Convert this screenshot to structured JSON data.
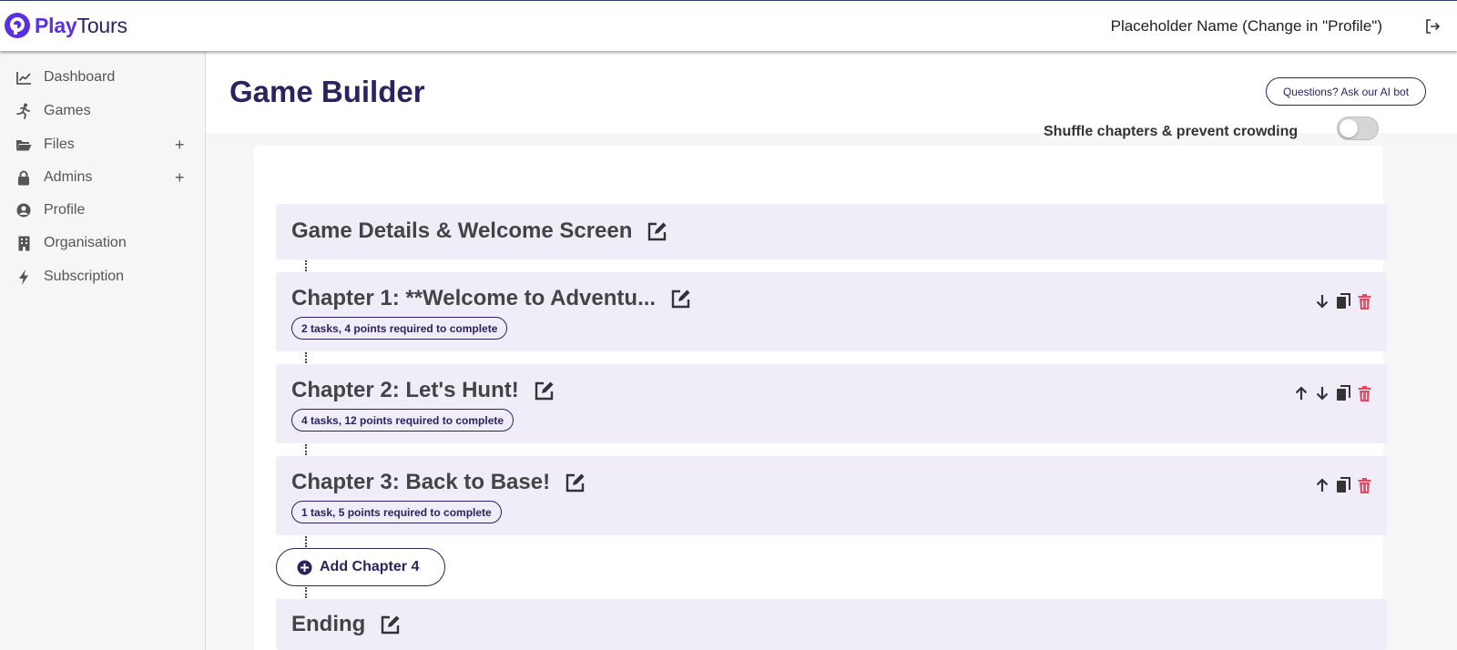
{
  "app": {
    "name_part1": "Play",
    "name_part2": "Tours"
  },
  "header": {
    "user_name": "Placeholder Name (Change in \"Profile\")"
  },
  "sidebar": {
    "items": [
      {
        "label": "Dashboard",
        "icon": "chart-line-icon"
      },
      {
        "label": "Games",
        "icon": "running-icon"
      },
      {
        "label": "Files",
        "icon": "folder-open-icon",
        "expandable": true
      },
      {
        "label": "Admins",
        "icon": "lock-icon",
        "expandable": true
      },
      {
        "label": "Profile",
        "icon": "user-circle-icon"
      },
      {
        "label": "Organisation",
        "icon": "building-icon"
      },
      {
        "label": "Subscription",
        "icon": "bolt-icon"
      }
    ],
    "expand_symbol": "+"
  },
  "page": {
    "title": "Game Builder",
    "ai_button": "Questions? Ask our AI bot"
  },
  "settings": {
    "shuffle_label": "Shuffle chapters & prevent crowding",
    "shuffle_enabled": false
  },
  "blocks": {
    "details": {
      "title": "Game Details & Welcome Screen"
    },
    "chapters": [
      {
        "title": "Chapter 1: **Welcome to Adventu...",
        "summary": "2 tasks, 4 points required to complete",
        "actions": [
          "move-down",
          "copy",
          "delete"
        ]
      },
      {
        "title": "Chapter 2: Let's Hunt!",
        "summary": "4 tasks, 12 points required to complete",
        "actions": [
          "move-up",
          "move-down",
          "copy",
          "delete"
        ]
      },
      {
        "title": "Chapter 3: Back to Base!",
        "summary": "1 task, 5 points required to complete",
        "actions": [
          "move-up",
          "copy",
          "delete"
        ]
      }
    ],
    "add_chapter_label": "Add Chapter 4",
    "ending": {
      "title": "Ending"
    }
  },
  "colors": {
    "brand": "#5a30e0",
    "navy": "#2a2360",
    "block_bg": "#f0edf9",
    "delete": "#e8485f"
  }
}
